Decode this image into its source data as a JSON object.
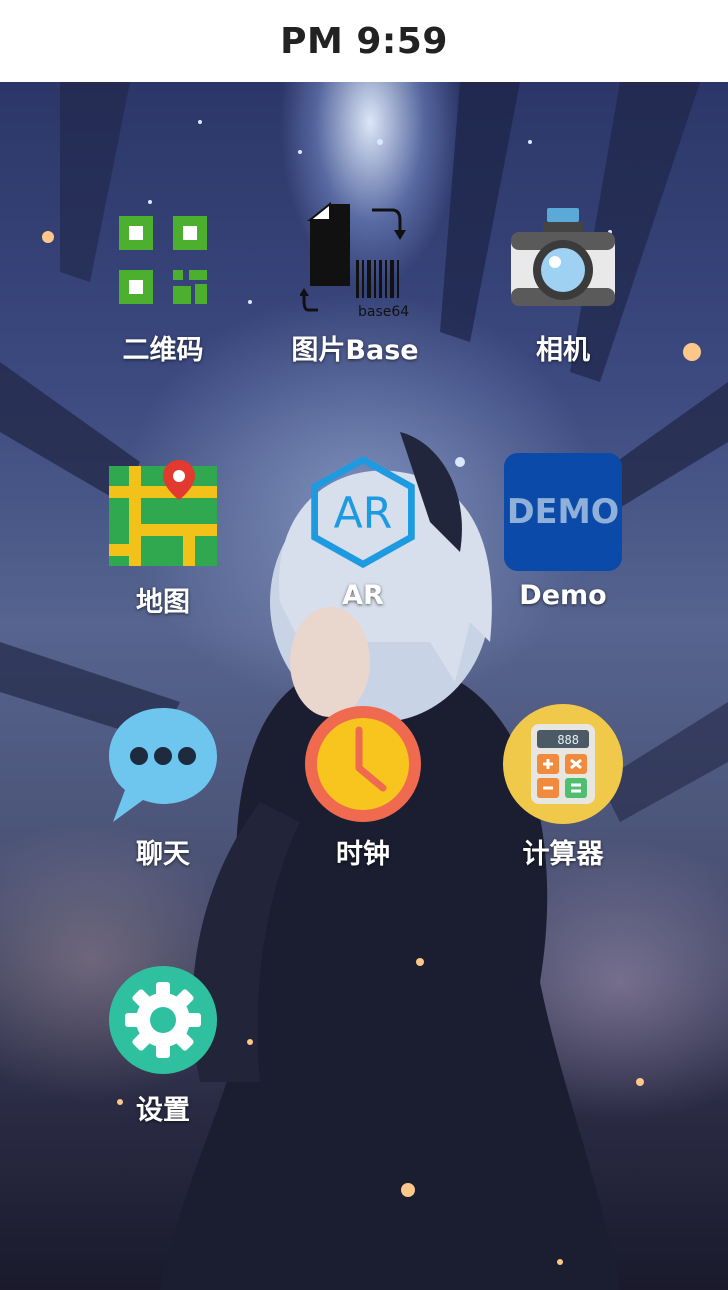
{
  "status_bar": {
    "time": "PM 9:59"
  },
  "apps": [
    {
      "label": "二维码",
      "icon": "qr-code-icon"
    },
    {
      "label": "图片Base",
      "icon": "image-base64-icon",
      "icon_text": "base64"
    },
    {
      "label": "相机",
      "icon": "camera-icon"
    },
    {
      "label": "地图",
      "icon": "map-icon"
    },
    {
      "label": "AR",
      "icon": "ar-icon",
      "icon_text": "AR"
    },
    {
      "label": "Demo",
      "icon": "demo-icon",
      "icon_text": "DEMO"
    },
    {
      "label": "聊天",
      "icon": "chat-icon"
    },
    {
      "label": "时钟",
      "icon": "clock-icon"
    },
    {
      "label": "计算器",
      "icon": "calculator-icon",
      "icon_text": "888"
    },
    {
      "label": "设置",
      "icon": "settings-icon"
    }
  ],
  "colors": {
    "qr_green": "#4caf2e",
    "map_green": "#2fa84f",
    "map_yellow": "#f2c21b",
    "ar_blue": "#1e9be0",
    "demo_blue": "#0b4aa8",
    "chat_blue": "#6ec6ee",
    "clock_red": "#ef6a4f",
    "clock_yellow": "#f7c51e",
    "calc_yellow": "#f1c94a",
    "settings_teal": "#2fc0a0"
  }
}
